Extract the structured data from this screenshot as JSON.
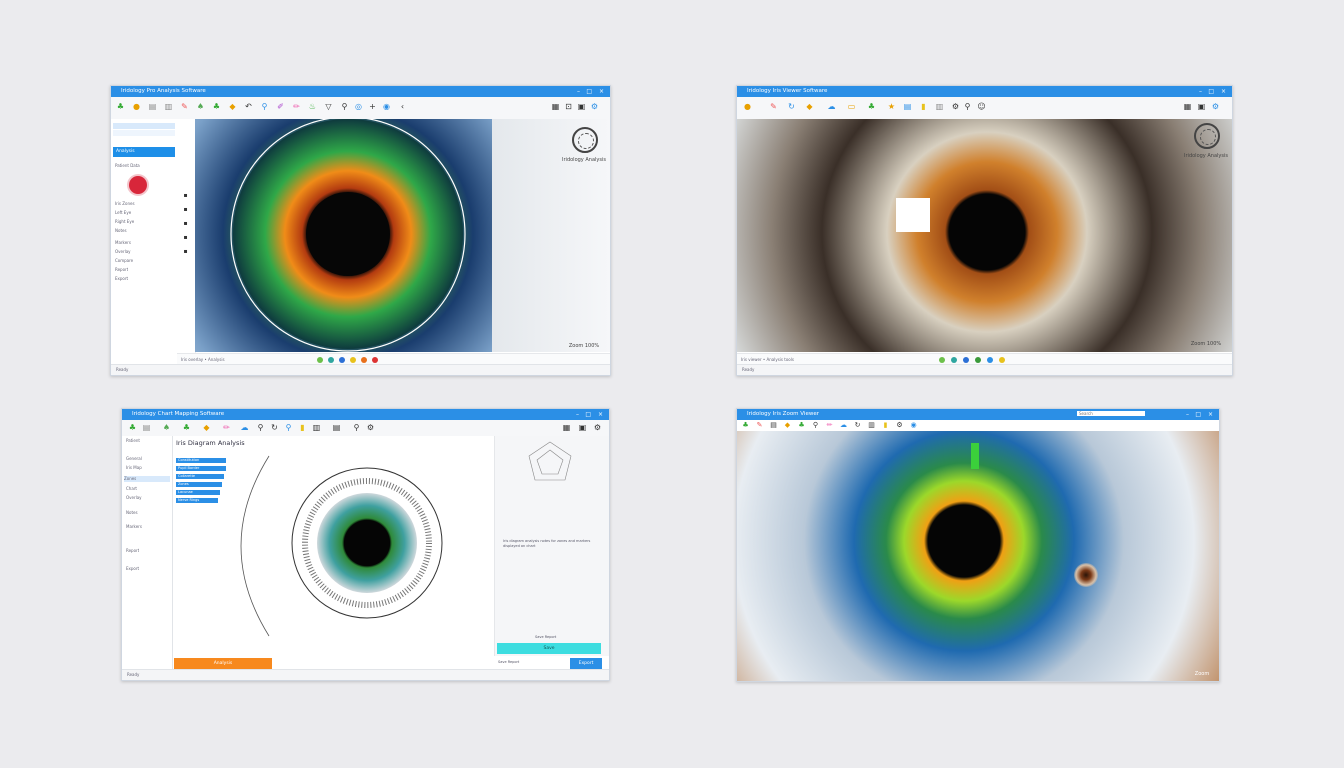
{
  "colors": {
    "accent": "#2b8fe6",
    "orange_button": "#f7891e",
    "cyan_button": "#3ddde0",
    "background": "#ebebee"
  },
  "windows": [
    {
      "title": "Iridology Pro Analysis Software",
      "sidebar": {
        "button_label": "Analysis",
        "rows": [
          "Patient Data",
          "Iris Zones",
          "Left Eye",
          "Right Eye",
          "Notes",
          "Markers",
          "Overlay",
          "Compare",
          "Report",
          "Export"
        ]
      },
      "brand_text": "Iridology Analysis",
      "footer_text": "Zoom 100%",
      "status_text": "Ready",
      "bottom_text": "Iris overlay • Analysis"
    },
    {
      "title": "Iridology Iris Viewer Software",
      "brand_text": "Iridology Analysis",
      "footer_text": "Zoom 100%",
      "status_text": "Ready",
      "bottom_text": "Iris viewer • Analysis tools"
    },
    {
      "title": "Iridology Chart Mapping Software",
      "sidebar": {
        "rows": [
          "Patient",
          "General",
          "Iris Map",
          "Zones",
          "Chart",
          "Overlay",
          "Notes",
          "Markers",
          "Report",
          "Export"
        ]
      },
      "heading": "Iris Diagram Analysis",
      "list_items": [
        "Constitution",
        "Pupil Border",
        "Collarette",
        "Zones",
        "Lacunae",
        "Nerve Rings"
      ],
      "notes_text": "Iris diagram analysis notes for zones and markers displayed on chart",
      "orange_button_label": "Analysis",
      "cyan_button_label": "Save",
      "cyan_heading": "Save Report",
      "blue_button_label": "Export",
      "footer_field_label": "Save Report",
      "status_text": "Ready"
    },
    {
      "title": "Iridology Iris Zoom Viewer",
      "search_placeholder": "Search",
      "footer_text": "Zoom"
    }
  ]
}
